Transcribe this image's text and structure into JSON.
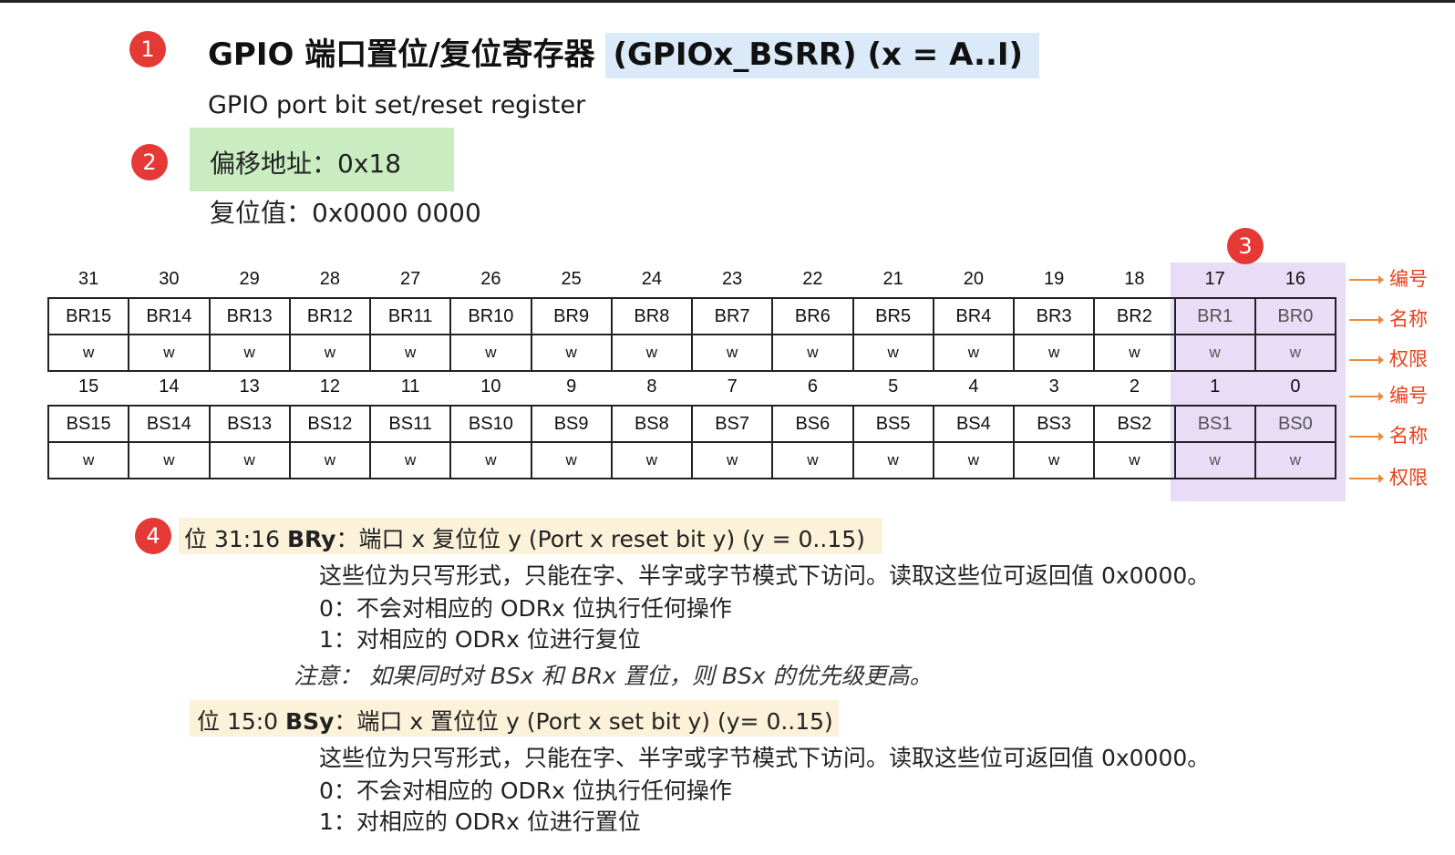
{
  "title": {
    "main": "GPIO 端口置位/复位寄存器",
    "highlight": "(GPIOx_BSRR) (x = A..I)"
  },
  "subtitle": "GPIO port bit set/reset register",
  "offset": "偏移地址：0x18",
  "reset_value": "复位值：0x0000 0000",
  "badges": [
    "1",
    "2",
    "3",
    "4"
  ],
  "register": {
    "upper": {
      "numbers": [
        "31",
        "30",
        "29",
        "28",
        "27",
        "26",
        "25",
        "24",
        "23",
        "22",
        "21",
        "20",
        "19",
        "18",
        "17",
        "16"
      ],
      "names": [
        "BR15",
        "BR14",
        "BR13",
        "BR12",
        "BR11",
        "BR10",
        "BR9",
        "BR8",
        "BR7",
        "BR6",
        "BR5",
        "BR4",
        "BR3",
        "BR2",
        "BR1",
        "BR0"
      ],
      "perms": [
        "w",
        "w",
        "w",
        "w",
        "w",
        "w",
        "w",
        "w",
        "w",
        "w",
        "w",
        "w",
        "w",
        "w",
        "w",
        "w"
      ]
    },
    "lower": {
      "numbers": [
        "15",
        "14",
        "13",
        "12",
        "11",
        "10",
        "9",
        "8",
        "7",
        "6",
        "5",
        "4",
        "3",
        "2",
        "1",
        "0"
      ],
      "names": [
        "BS15",
        "BS14",
        "BS13",
        "BS12",
        "BS11",
        "BS10",
        "BS9",
        "BS8",
        "BS7",
        "BS6",
        "BS5",
        "BS4",
        "BS3",
        "BS2",
        "BS1",
        "BS0"
      ],
      "perms": [
        "w",
        "w",
        "w",
        "w",
        "w",
        "w",
        "w",
        "w",
        "w",
        "w",
        "w",
        "w",
        "w",
        "w",
        "w",
        "w"
      ]
    }
  },
  "side_labels": {
    "number": "编号",
    "name": "名称",
    "permission": "权限"
  },
  "br_section": {
    "prefix": "位 31:16",
    "field": "BRy",
    "desc": "：端口 x 复位位 y (Port x reset bit y) (y = 0..15)",
    "line1": "这些位为只写形式，只能在字、半字或字节模式下访问。读取这些位可返回值 0x0000。",
    "line2": "0：不会对相应的 ODRx 位执行任何操作",
    "line3": "1：对相应的 ODRx 位进行复位",
    "note": "注意：  如果同时对 BSx 和 BRx 置位，则 BSx 的优先级更高。"
  },
  "bs_section": {
    "prefix": "位 15:0",
    "field": "BSy",
    "desc": "：端口 x 置位位 y (Port x set bit y) (y= 0..15)",
    "line1": "这些位为只写形式，只能在字、半字或字节模式下访问。读取这些位可返回值 0x0000。",
    "line2": "0：不会对相应的 ODRx 位执行任何操作",
    "line3": "1：对相应的 ODRx 位进行置位"
  }
}
